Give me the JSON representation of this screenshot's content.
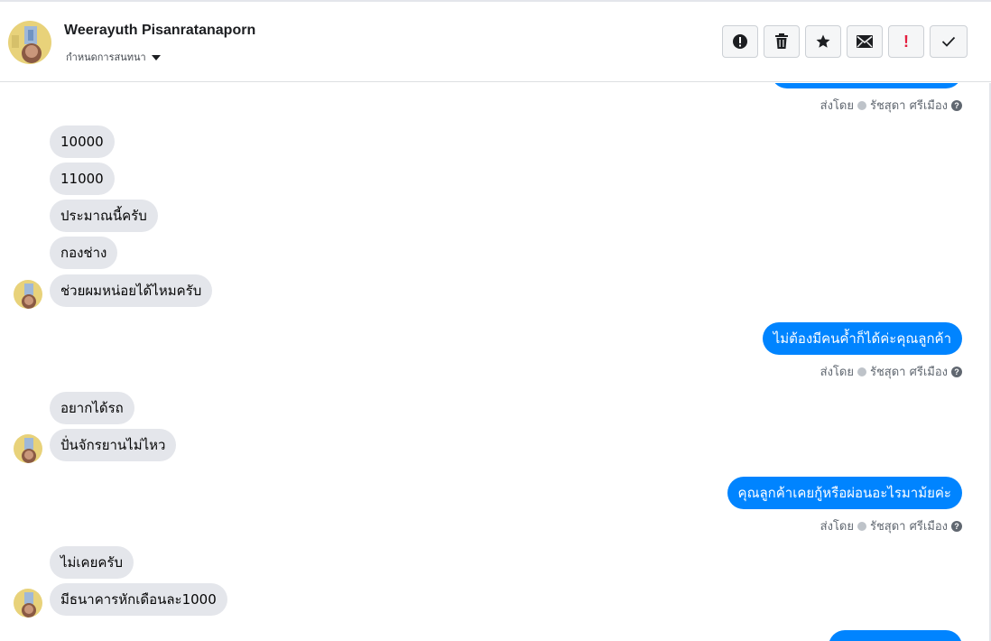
{
  "conversation": {
    "contact_name": "Weerayuth Pisanratanaporn",
    "assign_label": "กำหนดการสนทนา"
  },
  "toolbar": {
    "icons": [
      "alert-circle-icon",
      "trash-icon",
      "star-icon",
      "envelope-icon",
      "exclamation-red-icon",
      "checkmark-icon"
    ],
    "exclaim_text": "!"
  },
  "sent_by": {
    "prefix": "ส่งโดย",
    "agent": "รัชสุดา ศรีเมือง",
    "help": "?"
  },
  "messages": [
    {
      "dir": "out",
      "text": "",
      "sent_by": true
    },
    {
      "dir": "in",
      "text": "10000"
    },
    {
      "dir": "in",
      "text": "11000"
    },
    {
      "dir": "in",
      "text": "ประมาณนี้ครับ"
    },
    {
      "dir": "in",
      "text": "กองช่าง"
    },
    {
      "dir": "in",
      "text": "ช่วยผมหน่อยได้ไหมครับ",
      "avatar": true
    },
    {
      "dir": "out",
      "text": "ไม่ต้องมีคนค้ำก็ได้ค่ะคุณลูกค้า",
      "sent_by": true
    },
    {
      "dir": "in",
      "text": "อยากได้รถ"
    },
    {
      "dir": "in",
      "text": "ปั่นจักรยานไม่ไหว",
      "avatar": true
    },
    {
      "dir": "out",
      "text": "คุณลูกค้าเคยกู้หรือผ่อนอะไรมาม้ยค่ะ",
      "sent_by": true
    },
    {
      "dir": "in",
      "text": "ไม่เคยครับ"
    },
    {
      "dir": "in",
      "text": "มีธนาคารหักเดือนละ1000",
      "avatar": true
    },
    {
      "dir": "out",
      "text": ""
    }
  ],
  "colors": {
    "incoming_bubble": "#e4e6eb",
    "outgoing_bubble": "#0084ff",
    "alert_red": "#e41e3f"
  }
}
